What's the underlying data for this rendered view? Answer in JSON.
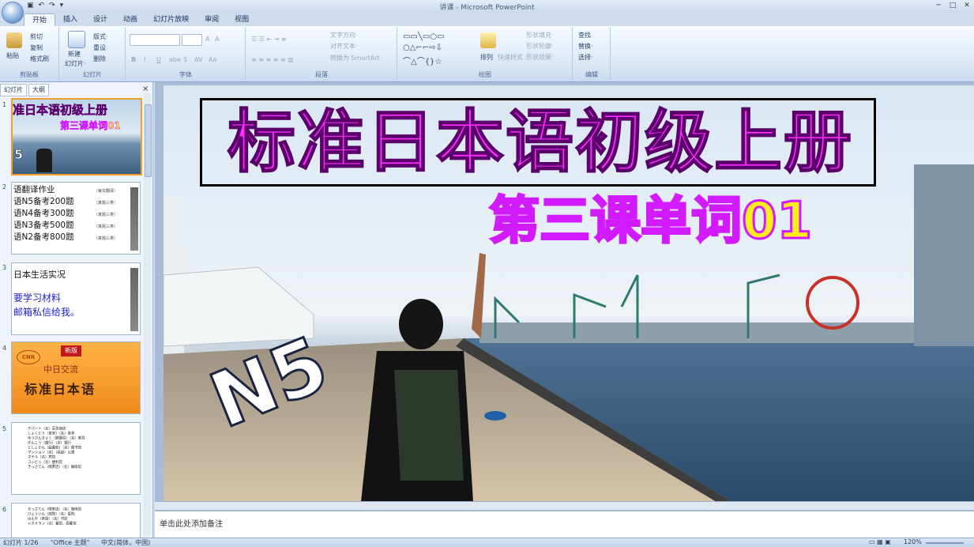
{
  "window": {
    "title": "讲课 - Microsoft PowerPoint"
  },
  "ribbon_tabs": [
    "开始",
    "插入",
    "设计",
    "动画",
    "幻灯片放映",
    "审阅",
    "视图"
  ],
  "clipboard": {
    "paste": "粘贴",
    "cut": "剪切",
    "copy": "复制",
    "format_painter": "格式刷",
    "label": "剪贴板"
  },
  "slides_group": {
    "new_slide": "新建",
    "new_slide2": "幻灯片·",
    "layout": "版式·",
    "reset": "重设",
    "delete": "删除",
    "label": "幻灯片"
  },
  "font_group": {
    "label": "字体",
    "bold": "B",
    "italic": "I",
    "underline": "U",
    "strike": "abe",
    "shadow": "S",
    "spacing": "AV",
    "case": "Aa",
    "grow": "A",
    "shrink": "A"
  },
  "paragraph_group": {
    "label": "段落",
    "text_direction": "文字方向·",
    "align_text": "对齐文本·",
    "smartart": "转换为 SmartArt·"
  },
  "drawing_group": {
    "label": "绘图",
    "arrange": "排列",
    "quick_styles": "快速样式",
    "shape_fill": "形状填充·",
    "shape_outline": "形状轮廓·",
    "shape_effects": "形状效果·"
  },
  "editing_group": {
    "label": "编辑",
    "find": "查找",
    "replace": "替换·",
    "select": "选择·"
  },
  "panel": {
    "tab_slides": "幻灯片",
    "tab_outline": "大纲",
    "close": "×"
  },
  "thumbnails": [
    {
      "num": "1",
      "line1": "准日本语初级上册",
      "line2": "第三课单词01",
      "badge": "5"
    },
    {
      "num": "2",
      "lines": [
        "语翻译作业",
        "语N5备考200题",
        "语N4备考300题",
        "语N3备考500题",
        "语N2备考800题"
      ],
      "tags": [
        "（每日翻译）",
        "（真题三类）",
        "（真题三类）",
        "（真题三类）",
        "（真题三类）"
      ]
    },
    {
      "num": "3",
      "lines": [
        "日本生活实况",
        "要学习材料",
        "邮箱私信给我。"
      ]
    },
    {
      "num": "4",
      "brand": "CNR",
      "badge": "新版",
      "line1": "中日交流",
      "line2": "标准日本语"
    },
    {
      "num": "5",
      "lines": [
        "デパート（名）百货商店",
        "しょくどう（食堂）（名）食堂",
        "ゆうびんきょく（郵便局）（名）邮局",
        "ぎんこう（銀行）（名）银行",
        "としょかん（図書館）（名）图书馆",
        "マンション（名）（高级）公寓",
        "ホテル（名）宾馆",
        "コンビニ（名）便利店",
        "きっさてん（喫茶店）（名）咖啡馆"
      ]
    },
    {
      "num": "6",
      "lines": [
        "きっさてん（喫茶店）（名）咖啡馆",
        "びょういん（病院）（名）医院",
        "ほんや（本屋）（名）书店",
        "レストラン（名）餐馆、西餐馆"
      ]
    }
  ],
  "slide": {
    "title": "标准日本语初级上册",
    "subtitle": "第三课单词01",
    "badge": "N5"
  },
  "notes": {
    "placeholder": "单击此处添加备注"
  },
  "status": {
    "slide": "幻灯片 1/26",
    "theme": "\"Office 主题\"",
    "language": "中文(简体，中国)",
    "zoom": "120%"
  },
  "colors": {
    "title": "#ff2dff",
    "subtitle": "#ffec1a",
    "accent": "#f0a030"
  }
}
